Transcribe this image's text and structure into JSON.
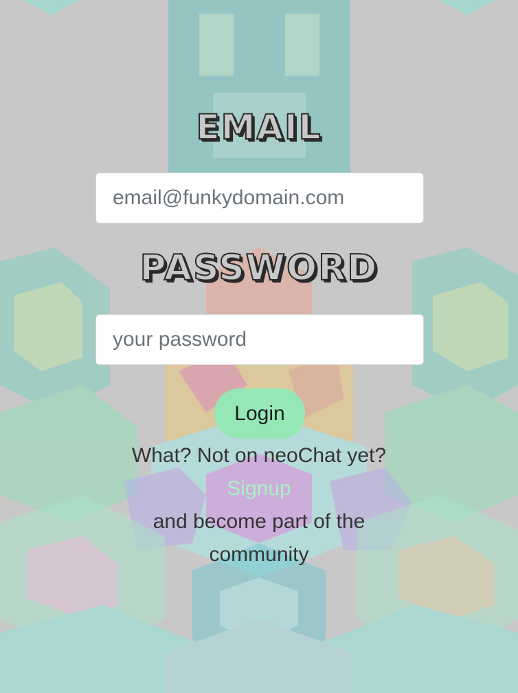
{
  "login_form": {
    "email_heading": "EMAIL",
    "email_placeholder": "email@funkydomain.com",
    "password_heading": "PASSWORD",
    "password_placeholder": "your password",
    "login_button": "Login"
  },
  "signup_prompt": {
    "question": "What? Not on neoChat yet?",
    "link": "Signup",
    "tagline_1": "and become part of the",
    "tagline_2": "community"
  },
  "colors": {
    "background": "#c8c8c8",
    "accent_green": "#95e8b6",
    "signup_link": "#a9f0c4",
    "text": "#343434"
  }
}
